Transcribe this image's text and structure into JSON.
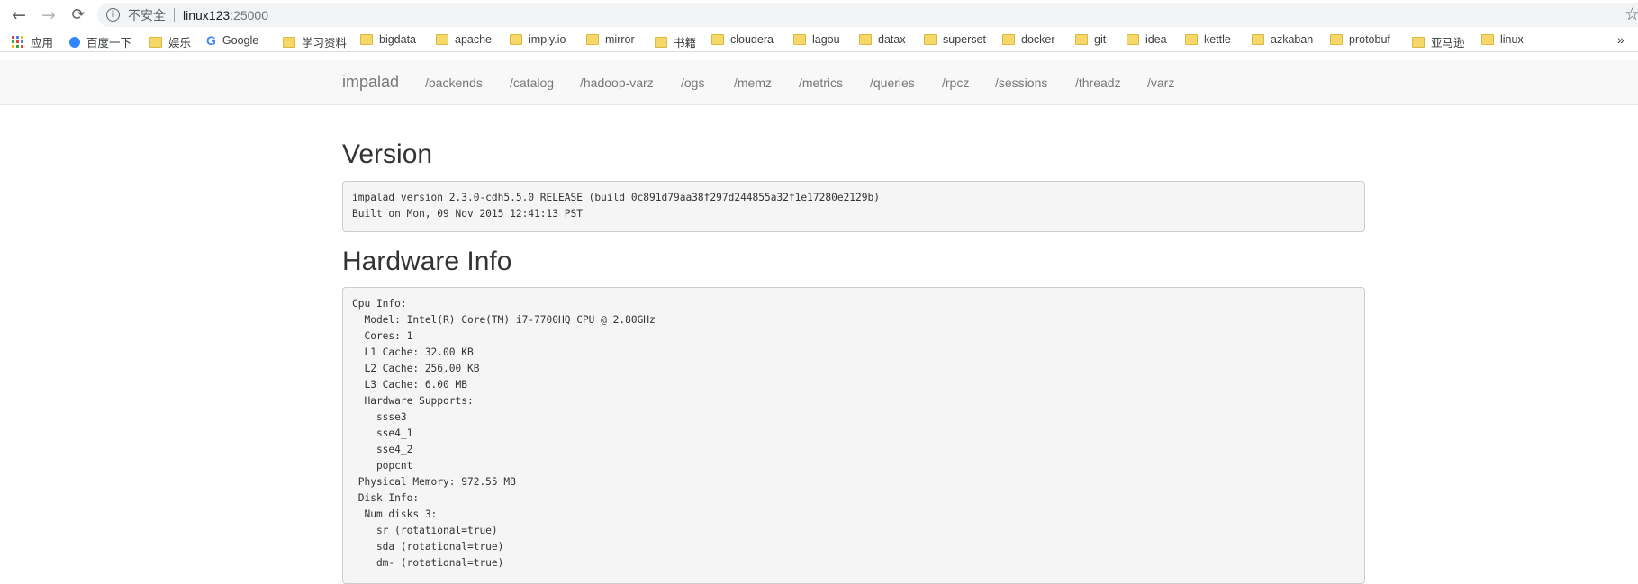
{
  "browser": {
    "insecure_label": "不安全",
    "url_host": "linux123",
    "url_port": ":25000",
    "back_glyph": "←",
    "forward_glyph": "→",
    "reload_glyph": "⟳",
    "info_glyph": "i",
    "star_glyph": "☆",
    "more_glyph": "»"
  },
  "bookmarks": {
    "apps": "应用",
    "baidu": "百度一下",
    "google": "Google",
    "google_logo": "G",
    "items": [
      "娱乐",
      "学习资料",
      "bigdata",
      "apache",
      "imply.io",
      "mirror",
      "书籍",
      "cloudera",
      "lagou",
      "datax",
      "superset",
      "docker",
      "git",
      "idea",
      "kettle",
      "azkaban",
      "protobuf",
      "亚马逊",
      "linux"
    ]
  },
  "navbar": {
    "brand": "impalad",
    "links": [
      "/backends",
      "/catalog",
      "/hadoop-varz",
      "/ogs",
      "/memz",
      "/metrics",
      "/queries",
      "/rpcz",
      "/sessions",
      "/threadz",
      "/varz"
    ]
  },
  "version": {
    "heading": "Version",
    "text": "impalad version 2.3.0-cdh5.5.0 RELEASE (build 0c891d79aa38f297d244855a32f1e17280e2129b)\nBuilt on Mon, 09 Nov 2015 12:41:13 PST"
  },
  "hardware": {
    "heading": "Hardware Info",
    "text": "Cpu Info:\n  Model: Intel(R) Core(TM) i7-7700HQ CPU @ 2.80GHz\n  Cores: 1\n  L1 Cache: 32.00 KB\n  L2 Cache: 256.00 KB\n  L3 Cache: 6.00 MB\n  Hardware Supports:\n    ssse3\n    sse4_1\n    sse4_2\n    popcnt\n Physical Memory: 972.55 MB\n Disk Info:\n  Num disks 3:\n    sr (rotational=true)\n    sda (rotational=true)\n    dm- (rotational=true)"
  },
  "colors": {
    "navbar_bg": "#f8f8f8",
    "pre_bg": "#f5f5f5",
    "folder": "#f5d867"
  }
}
